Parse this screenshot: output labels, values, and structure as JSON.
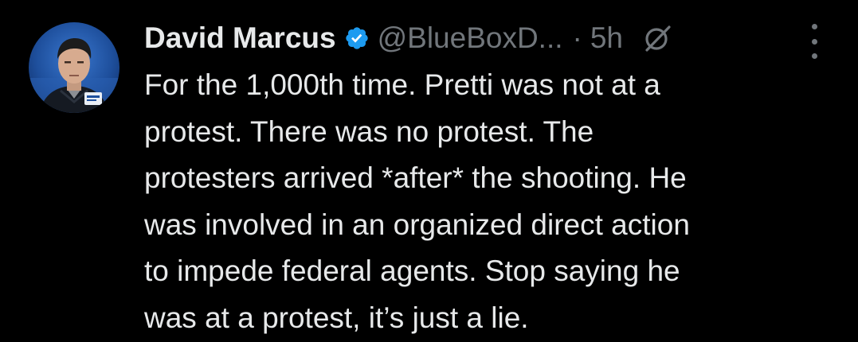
{
  "author": {
    "display_name": "David Marcus",
    "handle": "@BlueBoxD...",
    "separator": "·",
    "timestamp": "5h",
    "verified": true
  },
  "tweet": {
    "lines": [
      "For the 1,000th time. Pretti was not at a",
      "protest. There was no protest. The",
      "protesters arrived *after* the shooting. He",
      "was involved in an organized direct action",
      "to impede federal agents. Stop saying he",
      "was at a protest, it’s just a lie."
    ]
  },
  "icons": {
    "verified": "verified-badge-icon",
    "grok": "grok-icon",
    "more": "more-options-icon"
  },
  "colors": {
    "background": "#000000",
    "text_primary": "#e7e9ea",
    "text_secondary": "#71767b",
    "verified_blue": "#1d9bf0"
  }
}
